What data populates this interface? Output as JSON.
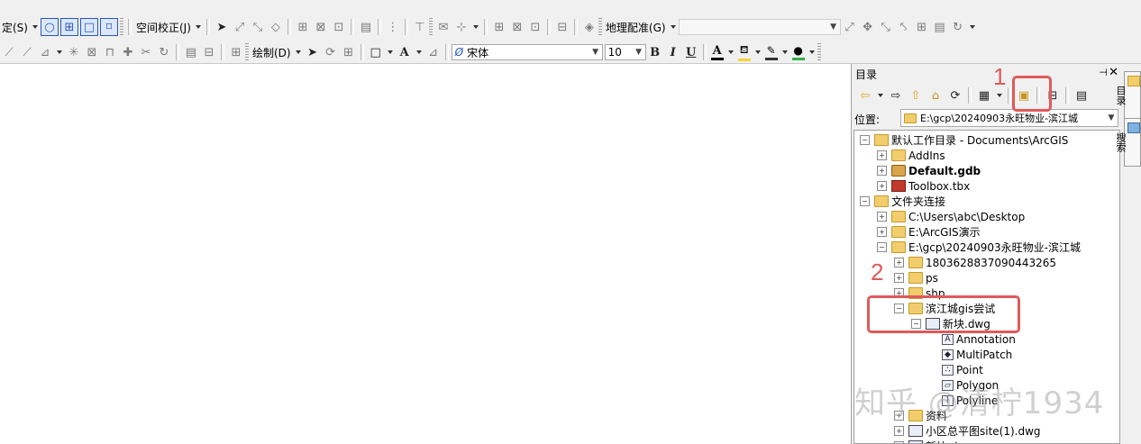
{
  "toolbar_row1": {
    "partial_menu": "定(S)",
    "spatial_adjust": "空间校正(J)",
    "georeference": "地理配准(G)"
  },
  "toolbar_row2": {
    "draw_menu": "绘制(D)",
    "font_name": "宋体",
    "font_size": "10",
    "bold": "B",
    "italic": "I",
    "underline": "U",
    "text_tool": "A"
  },
  "catalog": {
    "title": "目录",
    "location_label": "位置:",
    "location_value": "E:\\gcp\\20240903永旺物业-滨江城",
    "tree": [
      {
        "label": "默认工作目录 - Documents\\ArcGIS",
        "icon": "home-folder-icon",
        "indent": 0,
        "expander": "−"
      },
      {
        "label": "AddIns",
        "icon": "folder-icon",
        "indent": 1,
        "expander": "+"
      },
      {
        "label": "Default.gdb",
        "icon": "geodatabase-icon",
        "indent": 1,
        "expander": "+",
        "bold": true
      },
      {
        "label": "Toolbox.tbx",
        "icon": "toolbox-icon",
        "indent": 1,
        "expander": "+"
      },
      {
        "label": "文件夹连接",
        "icon": "folder-connections-icon",
        "indent": 0,
        "expander": "−"
      },
      {
        "label": "C:\\Users\\abc\\Desktop",
        "icon": "folder-icon",
        "indent": 1,
        "expander": "+"
      },
      {
        "label": "E:\\ArcGIS演示",
        "icon": "folder-icon",
        "indent": 1,
        "expander": "+"
      },
      {
        "label": "E:\\gcp\\20240903永旺物业-滨江城",
        "icon": "folder-icon",
        "indent": 1,
        "expander": "−"
      },
      {
        "label": "1803628837090443265",
        "icon": "folder-icon",
        "indent": 2,
        "expander": "+"
      },
      {
        "label": "ps",
        "icon": "folder-icon",
        "indent": 2,
        "expander": "+"
      },
      {
        "label": "shp",
        "icon": "folder-icon",
        "indent": 2,
        "expander": "+"
      },
      {
        "label": "滨江城gis尝试",
        "icon": "folder-icon",
        "indent": 2,
        "expander": "−"
      },
      {
        "label": "新块.dwg",
        "icon": "cad-dataset-icon",
        "indent": 3,
        "expander": "−"
      },
      {
        "label": "Annotation",
        "icon": "annotation-layer-icon",
        "indent": 4,
        "expander": "",
        "glyph": "A"
      },
      {
        "label": "MultiPatch",
        "icon": "multipatch-layer-icon",
        "indent": 4,
        "expander": "",
        "glyph": "◆"
      },
      {
        "label": "Point",
        "icon": "point-layer-icon",
        "indent": 4,
        "expander": "",
        "glyph": "∴"
      },
      {
        "label": "Polygon",
        "icon": "polygon-layer-icon",
        "indent": 4,
        "expander": "",
        "glyph": "▱"
      },
      {
        "label": "Polyline",
        "icon": "polyline-layer-icon",
        "indent": 4,
        "expander": "",
        "glyph": "⌇"
      },
      {
        "label": "资料",
        "icon": "folder-icon",
        "indent": 2,
        "expander": "+"
      },
      {
        "label": "小区总平图site(1).dwg",
        "icon": "cad-dataset-icon",
        "indent": 2,
        "expander": "+"
      },
      {
        "label": "新块.dwg",
        "icon": "cad-dataset-icon",
        "indent": 2,
        "expander": "+"
      }
    ]
  },
  "side_tabs": [
    "目录",
    "搜索"
  ],
  "annotations": {
    "num1": "1",
    "num2": "2"
  },
  "watermark": "知乎 @清柠1934",
  "colors": {
    "annotation_red": "#e05a5a",
    "folder_yellow": "#f2cd6b",
    "panel_bg": "#f0f0f0"
  }
}
